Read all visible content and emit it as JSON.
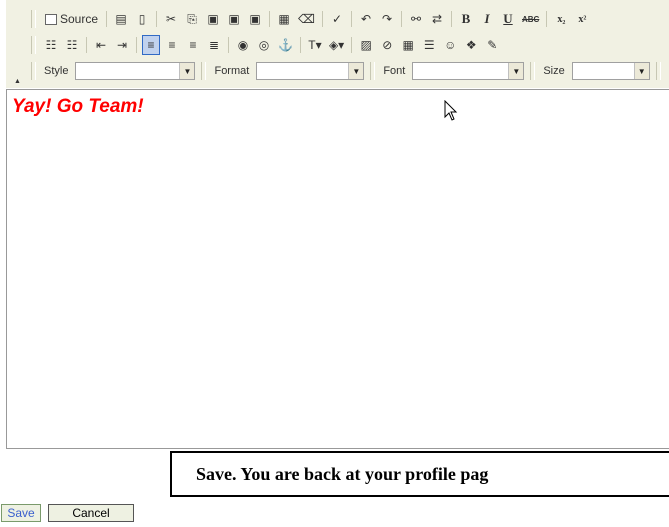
{
  "toolbar": {
    "source_label": "Source",
    "style_label": "Style",
    "format_label": "Format",
    "font_label": "Font",
    "size_label": "Size",
    "help_glyph": "?",
    "icons": {
      "save-icon": "🗎",
      "cut": "✂",
      "copy": "⎘",
      "paste": "📋",
      "undo": "↶",
      "redo": "↷",
      "find": "🔍",
      "bold": "B",
      "italic": "I",
      "underline": "U",
      "strike": "ABC",
      "subscript": "x₂",
      "superscript": "x²",
      "ol": "☰",
      "ul": "☰",
      "link": "🔗",
      "anchor": "⚓",
      "smiley": "☺"
    }
  },
  "editor": {
    "content_text": "Yay! Go Team!",
    "content_color": "#ff0000"
  },
  "callout": {
    "text": "Save. You are back at your profile pag"
  },
  "form": {
    "save_label": "Save",
    "cancel_label": "Cancel"
  },
  "colors": {
    "toolbar_bg": "#f1f1e3",
    "active_button_border": "#316ac5",
    "save_text": "#3a5fcd"
  }
}
